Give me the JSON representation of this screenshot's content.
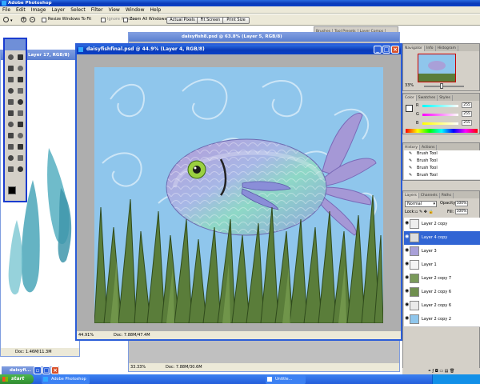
{
  "app": {
    "title": "Adobe Photoshop",
    "menus": [
      "File",
      "Edit",
      "Image",
      "Layer",
      "Select",
      "Filter",
      "View",
      "Window",
      "Help"
    ]
  },
  "options_bar": {
    "resize_windows_label": "Resize Windows To Fit",
    "ignore_palettes_label": "Ignore Palettes",
    "zoom_all_windows_label": "Zoom All Windows",
    "actual_pixels_label": "Actual Pixels",
    "fit_screen_label": "Fit Screen",
    "print_size_label": "Print Size",
    "resize_windows_checked": false,
    "ignore_palettes_checked": false,
    "zoom_all_windows_checked": false
  },
  "palette_well": {
    "tabs": [
      "Brushes",
      "Tool Presets",
      "Layer Comps"
    ]
  },
  "toolbox": {
    "tools": [
      "move",
      "marquee",
      "lasso",
      "magic-wand",
      "crop",
      "slice",
      "healing",
      "brush",
      "stamp",
      "history-brush",
      "eraser",
      "gradient",
      "blur",
      "dodge",
      "path-select",
      "type",
      "pen",
      "shape",
      "notes",
      "eyedropper",
      "hand",
      "zoom"
    ],
    "foreground_color": "#000000",
    "background_color": "#ffffff"
  },
  "windows": {
    "back_doc": {
      "title": "Layer 17, RGB/8)",
      "status_zoom": "",
      "status_doc": "Doc: 1.46M/11.3M"
    },
    "mid_doc": {
      "title": "daisyfish8.psd @ 63.8% (Layer 5, RGB/8)",
      "status_zoom": "33.33%",
      "status_doc": "Doc: 7.88M/30.6M"
    },
    "main_doc": {
      "title": "daisyfishfinal.psd @ 44.9% (Layer 4, RGB/8)",
      "status_zoom": "44.91%",
      "status_doc": "Doc: 7.88M/47.4M"
    },
    "minimized": {
      "title": "daisyfi..."
    }
  },
  "navigator": {
    "tabs": [
      "Navigator",
      "Info",
      "Histogram"
    ],
    "zoom": "33%"
  },
  "color_panel": {
    "tabs": [
      "Color",
      "Swatches",
      "Styles"
    ],
    "channels": [
      {
        "label": "R",
        "value": "255",
        "color": "#ff0000",
        "fraction": 1.0
      },
      {
        "label": "G",
        "value": "255",
        "color": "#00ff00",
        "fraction": 1.0
      },
      {
        "label": "B",
        "value": "255",
        "color": "#0000ff",
        "fraction": 1.0
      }
    ]
  },
  "history_panel": {
    "tabs": [
      "History",
      "Actions"
    ],
    "items": [
      "Brush Tool",
      "Brush Tool",
      "Brush Tool",
      "Brush Tool"
    ]
  },
  "layers_panel": {
    "tabs": [
      "Layers",
      "Channels",
      "Paths"
    ],
    "blend_mode": "Normal",
    "opacity_label": "Opacity:",
    "opacity": "100%",
    "lock_label": "Lock:",
    "fill_label": "Fill:",
    "fill": "100%",
    "layers": [
      {
        "name": "Layer 2 copy",
        "selected": false
      },
      {
        "name": "Layer 4 copy",
        "selected": true
      },
      {
        "name": "Layer 3",
        "selected": false
      },
      {
        "name": "Layer 1",
        "selected": false
      },
      {
        "name": "Layer 2 copy 7",
        "selected": false
      },
      {
        "name": "Layer 2 copy 6",
        "selected": false
      },
      {
        "name": "Layer 2 copy 6",
        "selected": false
      },
      {
        "name": "Layer 2 copy 2",
        "selected": false
      }
    ]
  },
  "taskbar": {
    "start_label": "start",
    "items": [
      "Adobe Photoshop",
      "Untitle..."
    ]
  },
  "colors": {
    "xp_blue": "#0a3ab8",
    "selection_blue": "#3165d4",
    "sky_blue": "#8fc6ec",
    "fish_purple": "#a9a0d8",
    "grass_green": "#5a7d3a"
  }
}
